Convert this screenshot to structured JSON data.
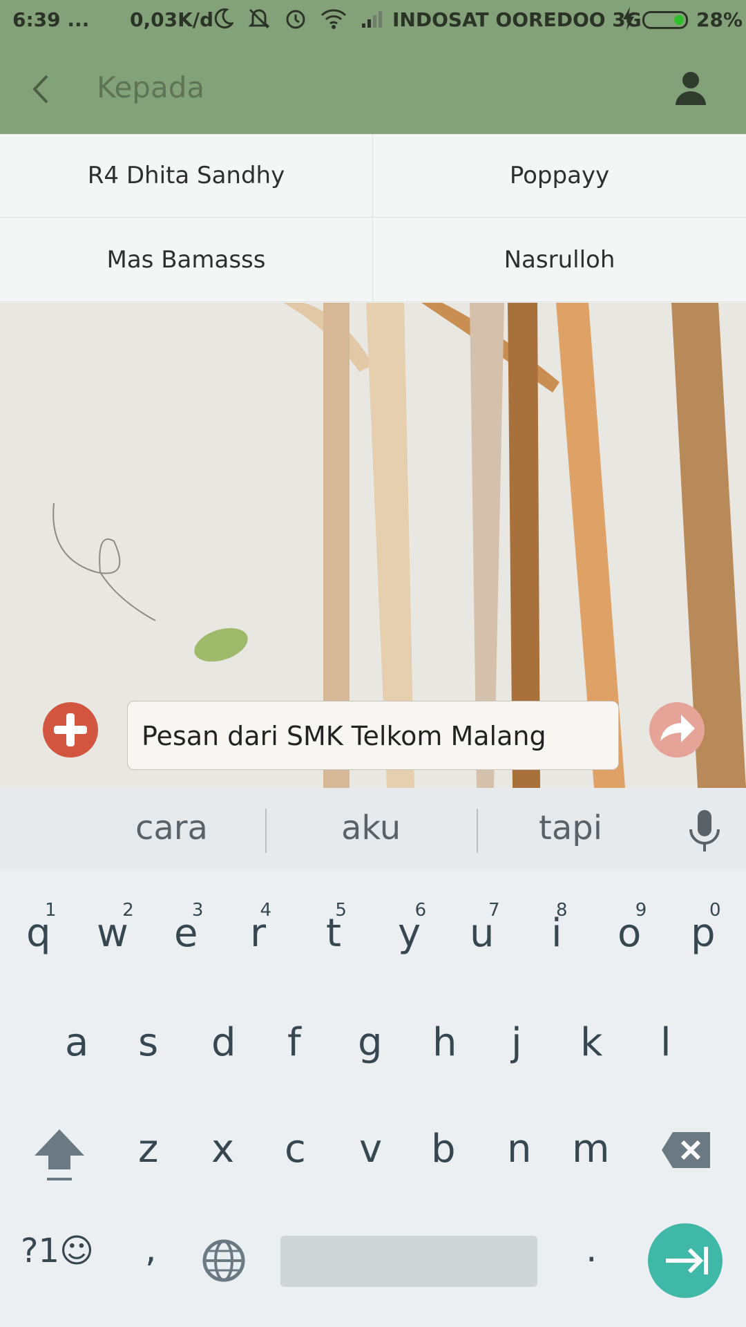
{
  "status_bar": {
    "time": "6:39",
    "dots": "...",
    "speed": "0,03K/d",
    "carrier": "INDOSAT OOREDOO 3G",
    "battery": "28%"
  },
  "header": {
    "title": "Kepada"
  },
  "recipients": [
    "R4 Dhita Sandhy",
    "Poppayy",
    "Mas Bamasss",
    "Nasrulloh"
  ],
  "compose": {
    "message": "Pesan dari SMK Telkom Malang"
  },
  "suggestions": [
    "cara",
    "aku",
    "tapi"
  ],
  "keyboard": {
    "row1": [
      "q",
      "w",
      "e",
      "r",
      "t",
      "y",
      "u",
      "i",
      "o",
      "p"
    ],
    "row1_hints": [
      "1",
      "2",
      "3",
      "4",
      "5",
      "6",
      "7",
      "8",
      "9",
      "0"
    ],
    "row2": [
      "a",
      "s",
      "d",
      "f",
      "g",
      "h",
      "j",
      "k",
      "l"
    ],
    "row3": [
      "z",
      "x",
      "c",
      "v",
      "b",
      "n",
      "m"
    ],
    "symbols_label": "?1☺",
    "comma": ",",
    "period": "."
  },
  "colors": {
    "header_bg": "#84a27a",
    "accent_enter": "#3fb8a8",
    "add_button": "#d2553f"
  }
}
